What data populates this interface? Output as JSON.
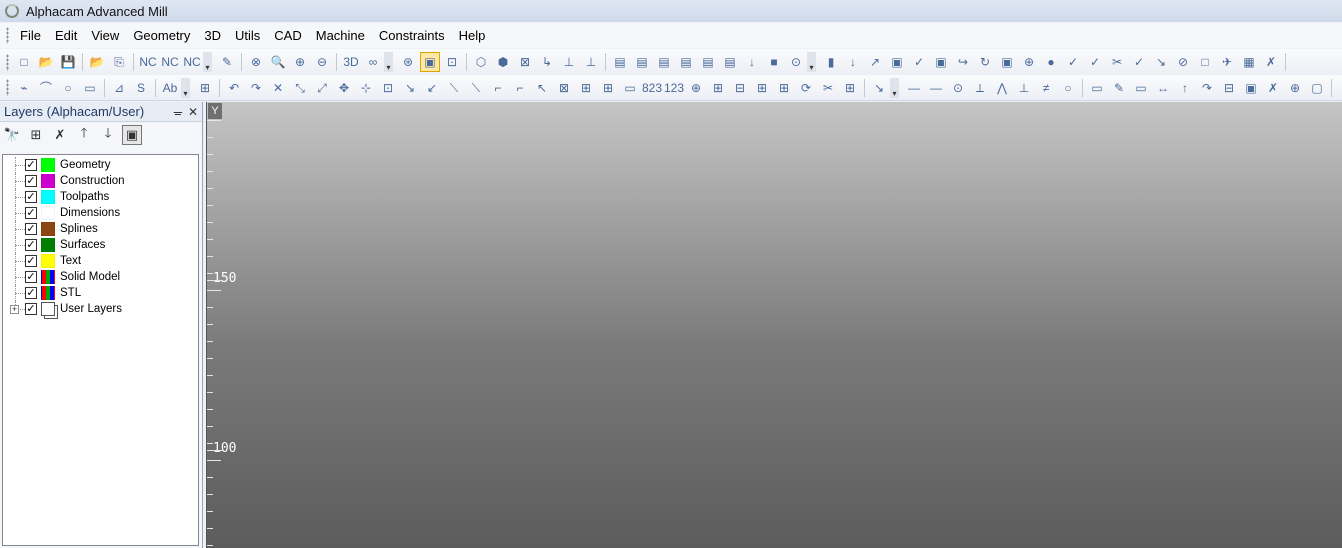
{
  "app": {
    "title": "Alphacam Advanced Mill"
  },
  "menu": [
    "File",
    "Edit",
    "View",
    "Geometry",
    "3D",
    "Utils",
    "CAD",
    "Machine",
    "Constraints",
    "Help"
  ],
  "toolbar1": {
    "groups": [
      [
        "□",
        "📂",
        "💾"
      ],
      [
        "📂",
        "⎘"
      ],
      [
        "NC",
        "NC",
        "NC"
      ],
      [
        "✎"
      ],
      [
        "⊗",
        "🔍",
        "⊕",
        "⊖"
      ],
      [
        "3D",
        "∞"
      ],
      [
        "⊛",
        "▣",
        "⊡"
      ],
      [
        "⬡",
        "⬢",
        "⊠",
        "↳",
        "⊥",
        "⊥"
      ],
      [
        "▤",
        "▤",
        "▤",
        "▤",
        "▤",
        "▤",
        "↓",
        "■",
        "⊙"
      ],
      [
        "▮",
        "↓",
        "↗",
        "▣",
        "✓",
        "▣",
        "↪",
        "↻",
        "▣",
        "⊕",
        "●",
        "✓",
        "✓",
        "✂",
        "✓",
        "↘",
        "⊘",
        "□",
        "✈",
        "▦",
        "✗"
      ]
    ],
    "active_index": 16
  },
  "toolbar2": {
    "groups": [
      [
        "⌁",
        "⌒",
        "○",
        "▭"
      ],
      [
        "⊿",
        "S"
      ],
      [
        "Ab"
      ],
      [
        "⊞"
      ],
      [
        "↶",
        "↷",
        "✕",
        "⤡",
        "⤢",
        "✥",
        "⊹",
        "⊡",
        "↘",
        "↙",
        "⟍",
        "⟍",
        "⌐",
        "⌐",
        "↖",
        "⊠",
        "⊞",
        "⊞",
        "▭",
        "823",
        "123",
        "⊕",
        "⊞",
        "⊟",
        "⊞",
        "⊞",
        "⟳",
        "✂",
        "⊞"
      ],
      [
        "↘"
      ],
      [
        "—",
        "—",
        "⊙",
        "⟂",
        "⋀",
        "⊥",
        "≠",
        "○"
      ],
      [
        "▭",
        "✎",
        "▭",
        "↔",
        "↑",
        "↷",
        "⊟",
        "▣",
        "✗",
        "⊕",
        "▢"
      ]
    ]
  },
  "layers_panel": {
    "title": "Layers (Alphacam/User)",
    "pin_icon": "ᚚ",
    "close_icon": "✕",
    "tools": [
      "🔭",
      "⊞",
      "✗",
      "🡑",
      "🡓",
      "▣"
    ],
    "items": [
      {
        "label": "Geometry",
        "checked": true,
        "color": "#00ff00"
      },
      {
        "label": "Construction",
        "checked": true,
        "color": "#cc00cc"
      },
      {
        "label": "Toolpaths",
        "checked": true,
        "color": "#00ffff"
      },
      {
        "label": "Dimensions",
        "checked": true,
        "color": "#ffffff"
      },
      {
        "label": "Splines",
        "checked": true,
        "color": "#8b4513"
      },
      {
        "label": "Surfaces",
        "checked": true,
        "color": "#008000"
      },
      {
        "label": "Text",
        "checked": true,
        "color": "#ffff00"
      },
      {
        "label": "Solid Model",
        "checked": true,
        "color": "rgb"
      },
      {
        "label": "STL",
        "checked": true,
        "color": "rgb"
      },
      {
        "label": "User Layers",
        "checked": true,
        "color": "layers",
        "expandable": true
      }
    ]
  },
  "viewport": {
    "axis_label": "Y",
    "ruler_labels": [
      "150",
      "100"
    ]
  }
}
